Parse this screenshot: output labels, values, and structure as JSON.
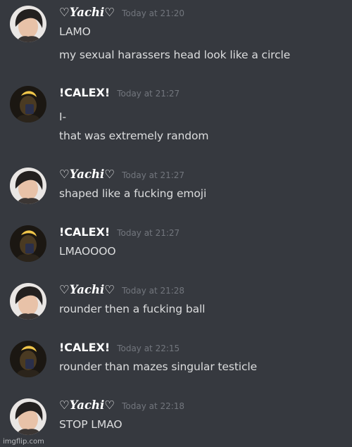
{
  "watermark": "imgflip.com",
  "messages": [
    {
      "author": "♡Yachi♡",
      "avatar": "avatar-dark-hair",
      "time": "Today at 21:20",
      "lines": [
        "LAMO",
        "my sexual harassers head look like a circle"
      ]
    },
    {
      "author": "!CALEX!",
      "avatar": "avatar-yellow-light",
      "time": "Today at 21:27",
      "lines": [
        "I-",
        "that was extremely random"
      ]
    },
    {
      "author": "♡Yachi♡",
      "avatar": "avatar-dark-hair",
      "time": "Today at 21:27",
      "lines": [
        "shaped like a fucking emoji"
      ]
    },
    {
      "author": "!CALEX!",
      "avatar": "avatar-yellow-light",
      "time": "Today at 21:27",
      "lines": [
        "LMAOOOO"
      ]
    },
    {
      "author": "♡Yachi♡",
      "avatar": "avatar-dark-hair",
      "time": "Today at 21:28",
      "lines": [
        "rounder then a fucking ball"
      ]
    },
    {
      "author": "!CALEX!",
      "avatar": "avatar-yellow-light",
      "time": "Today at 22:15",
      "lines": [
        "rounder than mazes singular testicle"
      ]
    },
    {
      "author": "♡Yachi♡",
      "avatar": "avatar-dark-hair",
      "time": "Today at 22:18",
      "lines": [
        "STOP LMAO"
      ]
    }
  ]
}
